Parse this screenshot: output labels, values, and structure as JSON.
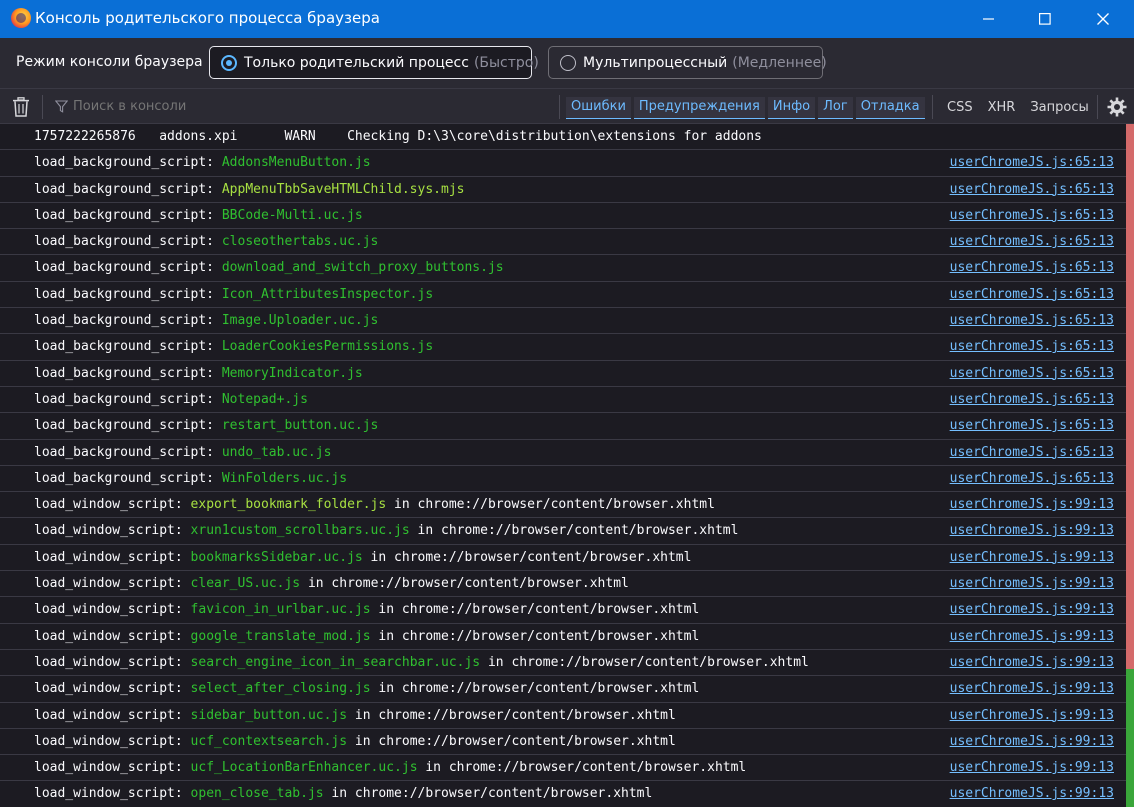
{
  "window": {
    "title": "Консоль родительского процесса браузера"
  },
  "mode": {
    "label": "Режим консоли браузера",
    "options": [
      {
        "label": "Только родительский процесс",
        "hint": "(Быстро)",
        "selected": true
      },
      {
        "label": "Мультипроцессный",
        "hint": "(Медленнее)",
        "selected": false
      }
    ]
  },
  "toolbar": {
    "search_placeholder": "Поиск в консоли",
    "filters": [
      "Ошибки",
      "Предупреждения",
      "Инфо",
      "Лог",
      "Отладка"
    ],
    "extra_filters": [
      "CSS",
      "XHR",
      "Запросы"
    ]
  },
  "colors": {
    "titlebar": "#0a6fd6",
    "link": "#75bfff",
    "file_green": "#30c030",
    "file_highlight": "#a7e042"
  },
  "log": [
    {
      "text": "1757222265876   addons.xpi      WARN    Checking D:\\3\\core\\distribution\\extensions for addons",
      "file": "",
      "suffix": "",
      "source": ""
    },
    {
      "text": "load_background_script: ",
      "file": "AddonsMenuButton.js",
      "suffix": "",
      "source": "userChromeJS.js:65:13"
    },
    {
      "text": "load_background_script: ",
      "file": "AppMenuTbbSaveHTMLChild.sys.mjs",
      "highlight": true,
      "suffix": "",
      "source": "userChromeJS.js:65:13"
    },
    {
      "text": "load_background_script: ",
      "file": "BBCode-Multi.uc.js",
      "suffix": "",
      "source": "userChromeJS.js:65:13"
    },
    {
      "text": "load_background_script: ",
      "file": "closeothertabs.uc.js",
      "suffix": "",
      "source": "userChromeJS.js:65:13"
    },
    {
      "text": "load_background_script: ",
      "file": "download_and_switch_proxy_buttons.js",
      "suffix": "",
      "source": "userChromeJS.js:65:13"
    },
    {
      "text": "load_background_script: ",
      "file": "Icon_AttributesInspector.js",
      "suffix": "",
      "source": "userChromeJS.js:65:13"
    },
    {
      "text": "load_background_script: ",
      "file": "Image.Uploader.uc.js",
      "suffix": "",
      "source": "userChromeJS.js:65:13"
    },
    {
      "text": "load_background_script: ",
      "file": "LoaderCookiesPermissions.js",
      "suffix": "",
      "source": "userChromeJS.js:65:13"
    },
    {
      "text": "load_background_script: ",
      "file": "MemoryIndicator.js",
      "suffix": "",
      "source": "userChromeJS.js:65:13"
    },
    {
      "text": "load_background_script: ",
      "file": "Notepad+.js",
      "suffix": "",
      "source": "userChromeJS.js:65:13"
    },
    {
      "text": "load_background_script: ",
      "file": "restart_button.uc.js",
      "suffix": "",
      "source": "userChromeJS.js:65:13"
    },
    {
      "text": "load_background_script: ",
      "file": "undo_tab.uc.js",
      "suffix": "",
      "source": "userChromeJS.js:65:13"
    },
    {
      "text": "load_background_script: ",
      "file": "WinFolders.uc.js",
      "suffix": "",
      "source": "userChromeJS.js:65:13"
    },
    {
      "text": "load_window_script: ",
      "file": "export_bookmark_folder.js",
      "highlight": true,
      "suffix": " in chrome://browser/content/browser.xhtml",
      "source": "userChromeJS.js:99:13"
    },
    {
      "text": "load_window_script: ",
      "file": "xrun1custom_scrollbars.uc.js",
      "suffix": " in chrome://browser/content/browser.xhtml",
      "source": "userChromeJS.js:99:13"
    },
    {
      "text": "load_window_script: ",
      "file": "bookmarksSidebar.uc.js",
      "suffix": " in chrome://browser/content/browser.xhtml",
      "source": "userChromeJS.js:99:13"
    },
    {
      "text": "load_window_script: ",
      "file": "clear_US.uc.js",
      "suffix": " in chrome://browser/content/browser.xhtml",
      "source": "userChromeJS.js:99:13"
    },
    {
      "text": "load_window_script: ",
      "file": "favicon_in_urlbar.uc.js",
      "suffix": " in chrome://browser/content/browser.xhtml",
      "source": "userChromeJS.js:99:13"
    },
    {
      "text": "load_window_script: ",
      "file": "google_translate_mod.js",
      "suffix": " in chrome://browser/content/browser.xhtml",
      "source": "userChromeJS.js:99:13"
    },
    {
      "text": "load_window_script: ",
      "file": "search_engine_icon_in_searchbar.uc.js",
      "suffix": " in chrome://browser/content/browser.xhtml",
      "source": "userChromeJS.js:99:13"
    },
    {
      "text": "load_window_script: ",
      "file": "select_after_closing.js",
      "suffix": " in chrome://browser/content/browser.xhtml",
      "source": "userChromeJS.js:99:13"
    },
    {
      "text": "load_window_script: ",
      "file": "sidebar_button.uc.js",
      "suffix": " in chrome://browser/content/browser.xhtml",
      "source": "userChromeJS.js:99:13"
    },
    {
      "text": "load_window_script: ",
      "file": "ucf_contextsearch.js",
      "suffix": " in chrome://browser/content/browser.xhtml",
      "source": "userChromeJS.js:99:13"
    },
    {
      "text": "load_window_script: ",
      "file": "ucf_LocationBarEnhancer.uc.js",
      "suffix": " in chrome://browser/content/browser.xhtml",
      "source": "userChromeJS.js:99:13"
    },
    {
      "text": "load_window_script: ",
      "file": "open_close_tab.js",
      "suffix": " in chrome://browser/content/browser.xhtml",
      "source": "userChromeJS.js:99:13"
    }
  ]
}
